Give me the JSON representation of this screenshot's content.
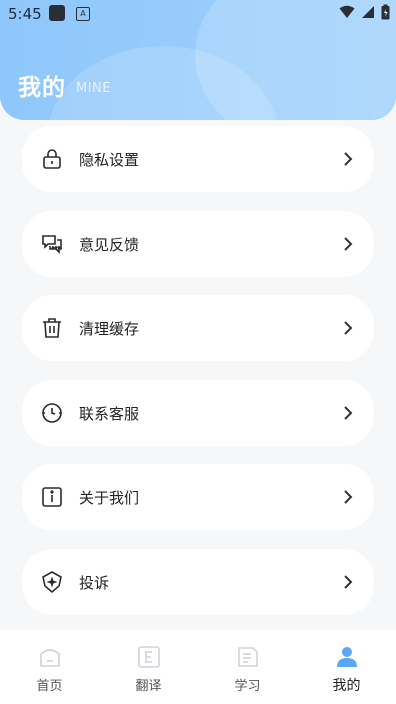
{
  "status_bar": {
    "time": "5:45",
    "notification_icons": [
      "app-square-icon",
      "a-icon"
    ],
    "right_icons": [
      "wifi-icon",
      "signal-icon",
      "battery-icon"
    ]
  },
  "header": {
    "title": "我的",
    "subtitle": "MINE",
    "colors": {
      "gradient_start": "#8fc7fb",
      "gradient_end": "#9fd0fc"
    }
  },
  "menu": {
    "items": [
      {
        "label": "隐私设置",
        "icon": "lock-icon"
      },
      {
        "label": "意见反馈",
        "icon": "chat-bubbles-icon"
      },
      {
        "label": "清理缓存",
        "icon": "trash-icon"
      },
      {
        "label": "联系客服",
        "icon": "clock-icon"
      },
      {
        "label": "关于我们",
        "icon": "info-icon"
      },
      {
        "label": "投诉",
        "icon": "shield-plus-icon"
      }
    ]
  },
  "tabbar": {
    "tabs": [
      {
        "label": "首页",
        "icon": "home-icon",
        "active": false
      },
      {
        "label": "翻译",
        "icon": "translate-icon",
        "active": false
      },
      {
        "label": "学习",
        "icon": "document-icon",
        "active": false
      },
      {
        "label": "我的",
        "icon": "user-icon",
        "active": true
      }
    ],
    "active_color": "#5aa8f5",
    "inactive_color": "#cfd3d8"
  }
}
